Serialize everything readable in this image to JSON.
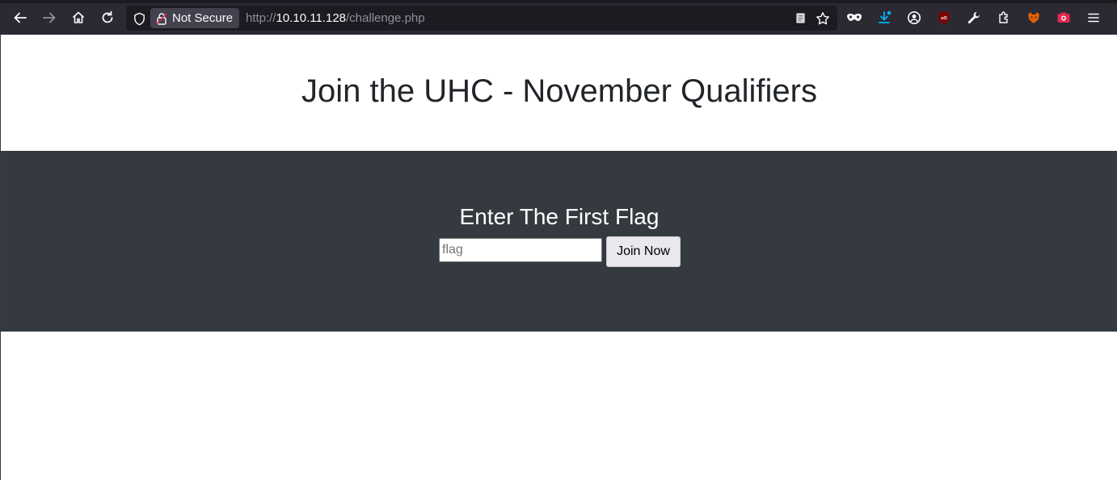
{
  "browser": {
    "security_label": "Not Secure",
    "url": {
      "scheme": "http://",
      "host": "10.10.11.128",
      "path": "/challenge.php"
    }
  },
  "page": {
    "title": "Join the UHC - November Qualifiers",
    "section_heading": "Enter The First Flag",
    "flag_input": {
      "placeholder": "flag",
      "value": ""
    },
    "submit_label": "Join Now"
  },
  "colors": {
    "toolbar_bg": "#2b2a33",
    "band_bg": "#343a40",
    "title_text": "#212529"
  },
  "icons": {
    "nav": [
      "back-arrow-icon",
      "forward-arrow-icon",
      "home-icon",
      "reload-icon"
    ],
    "url_bar": [
      "shield-icon",
      "lock-warning-icon",
      "reader-view-icon",
      "bookmark-star-icon"
    ],
    "extensions": [
      "private-mask-icon",
      "downloads-icon",
      "account-icon",
      "ublock-icon",
      "tools-icon",
      "extensions-icon",
      "foxyproxy-icon",
      "screenshot-icon",
      "menu-icon"
    ]
  }
}
